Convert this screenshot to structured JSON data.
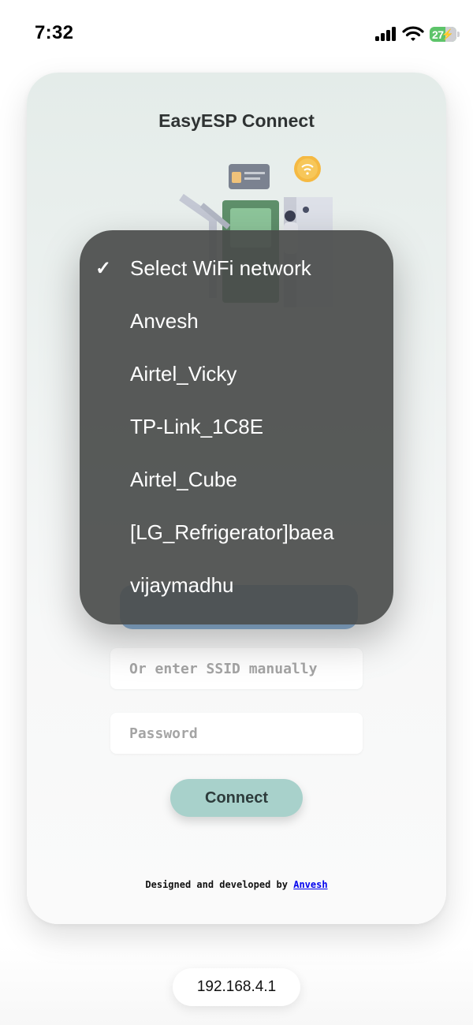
{
  "status_bar": {
    "time": "7:32",
    "battery_level": "27",
    "signal_icon": "cellular-signal-icon",
    "wifi_icon": "wifi-icon",
    "battery_icon": "battery-charging-icon"
  },
  "app": {
    "title": "EasyESP Connect",
    "illustration_icon": "wifi-setup-illustration"
  },
  "picker": {
    "items": [
      {
        "label": "Select WiFi network",
        "selected": true
      },
      {
        "label": "Anvesh",
        "selected": false
      },
      {
        "label": "Airtel_Vicky",
        "selected": false
      },
      {
        "label": "TP-Link_1C8E",
        "selected": false
      },
      {
        "label": "Airtel_Cube",
        "selected": false
      },
      {
        "label": "[LG_Refrigerator]baea",
        "selected": false
      },
      {
        "label": "vijaymadhu",
        "selected": false
      }
    ],
    "check_glyph": "✓"
  },
  "form": {
    "ssid_placeholder": "Or enter SSID manually",
    "password_placeholder": "Password",
    "connect_label": "Connect"
  },
  "footer": {
    "credit_prefix": "Designed and developed by ",
    "credit_link": "Anvesh"
  },
  "browser": {
    "url": "192.168.4.1"
  },
  "colors": {
    "accent_button": "#a8d1cb",
    "picker_background": "#4a4c4b",
    "select_highlight": "#8fb4d8",
    "link": "#0000ee"
  }
}
